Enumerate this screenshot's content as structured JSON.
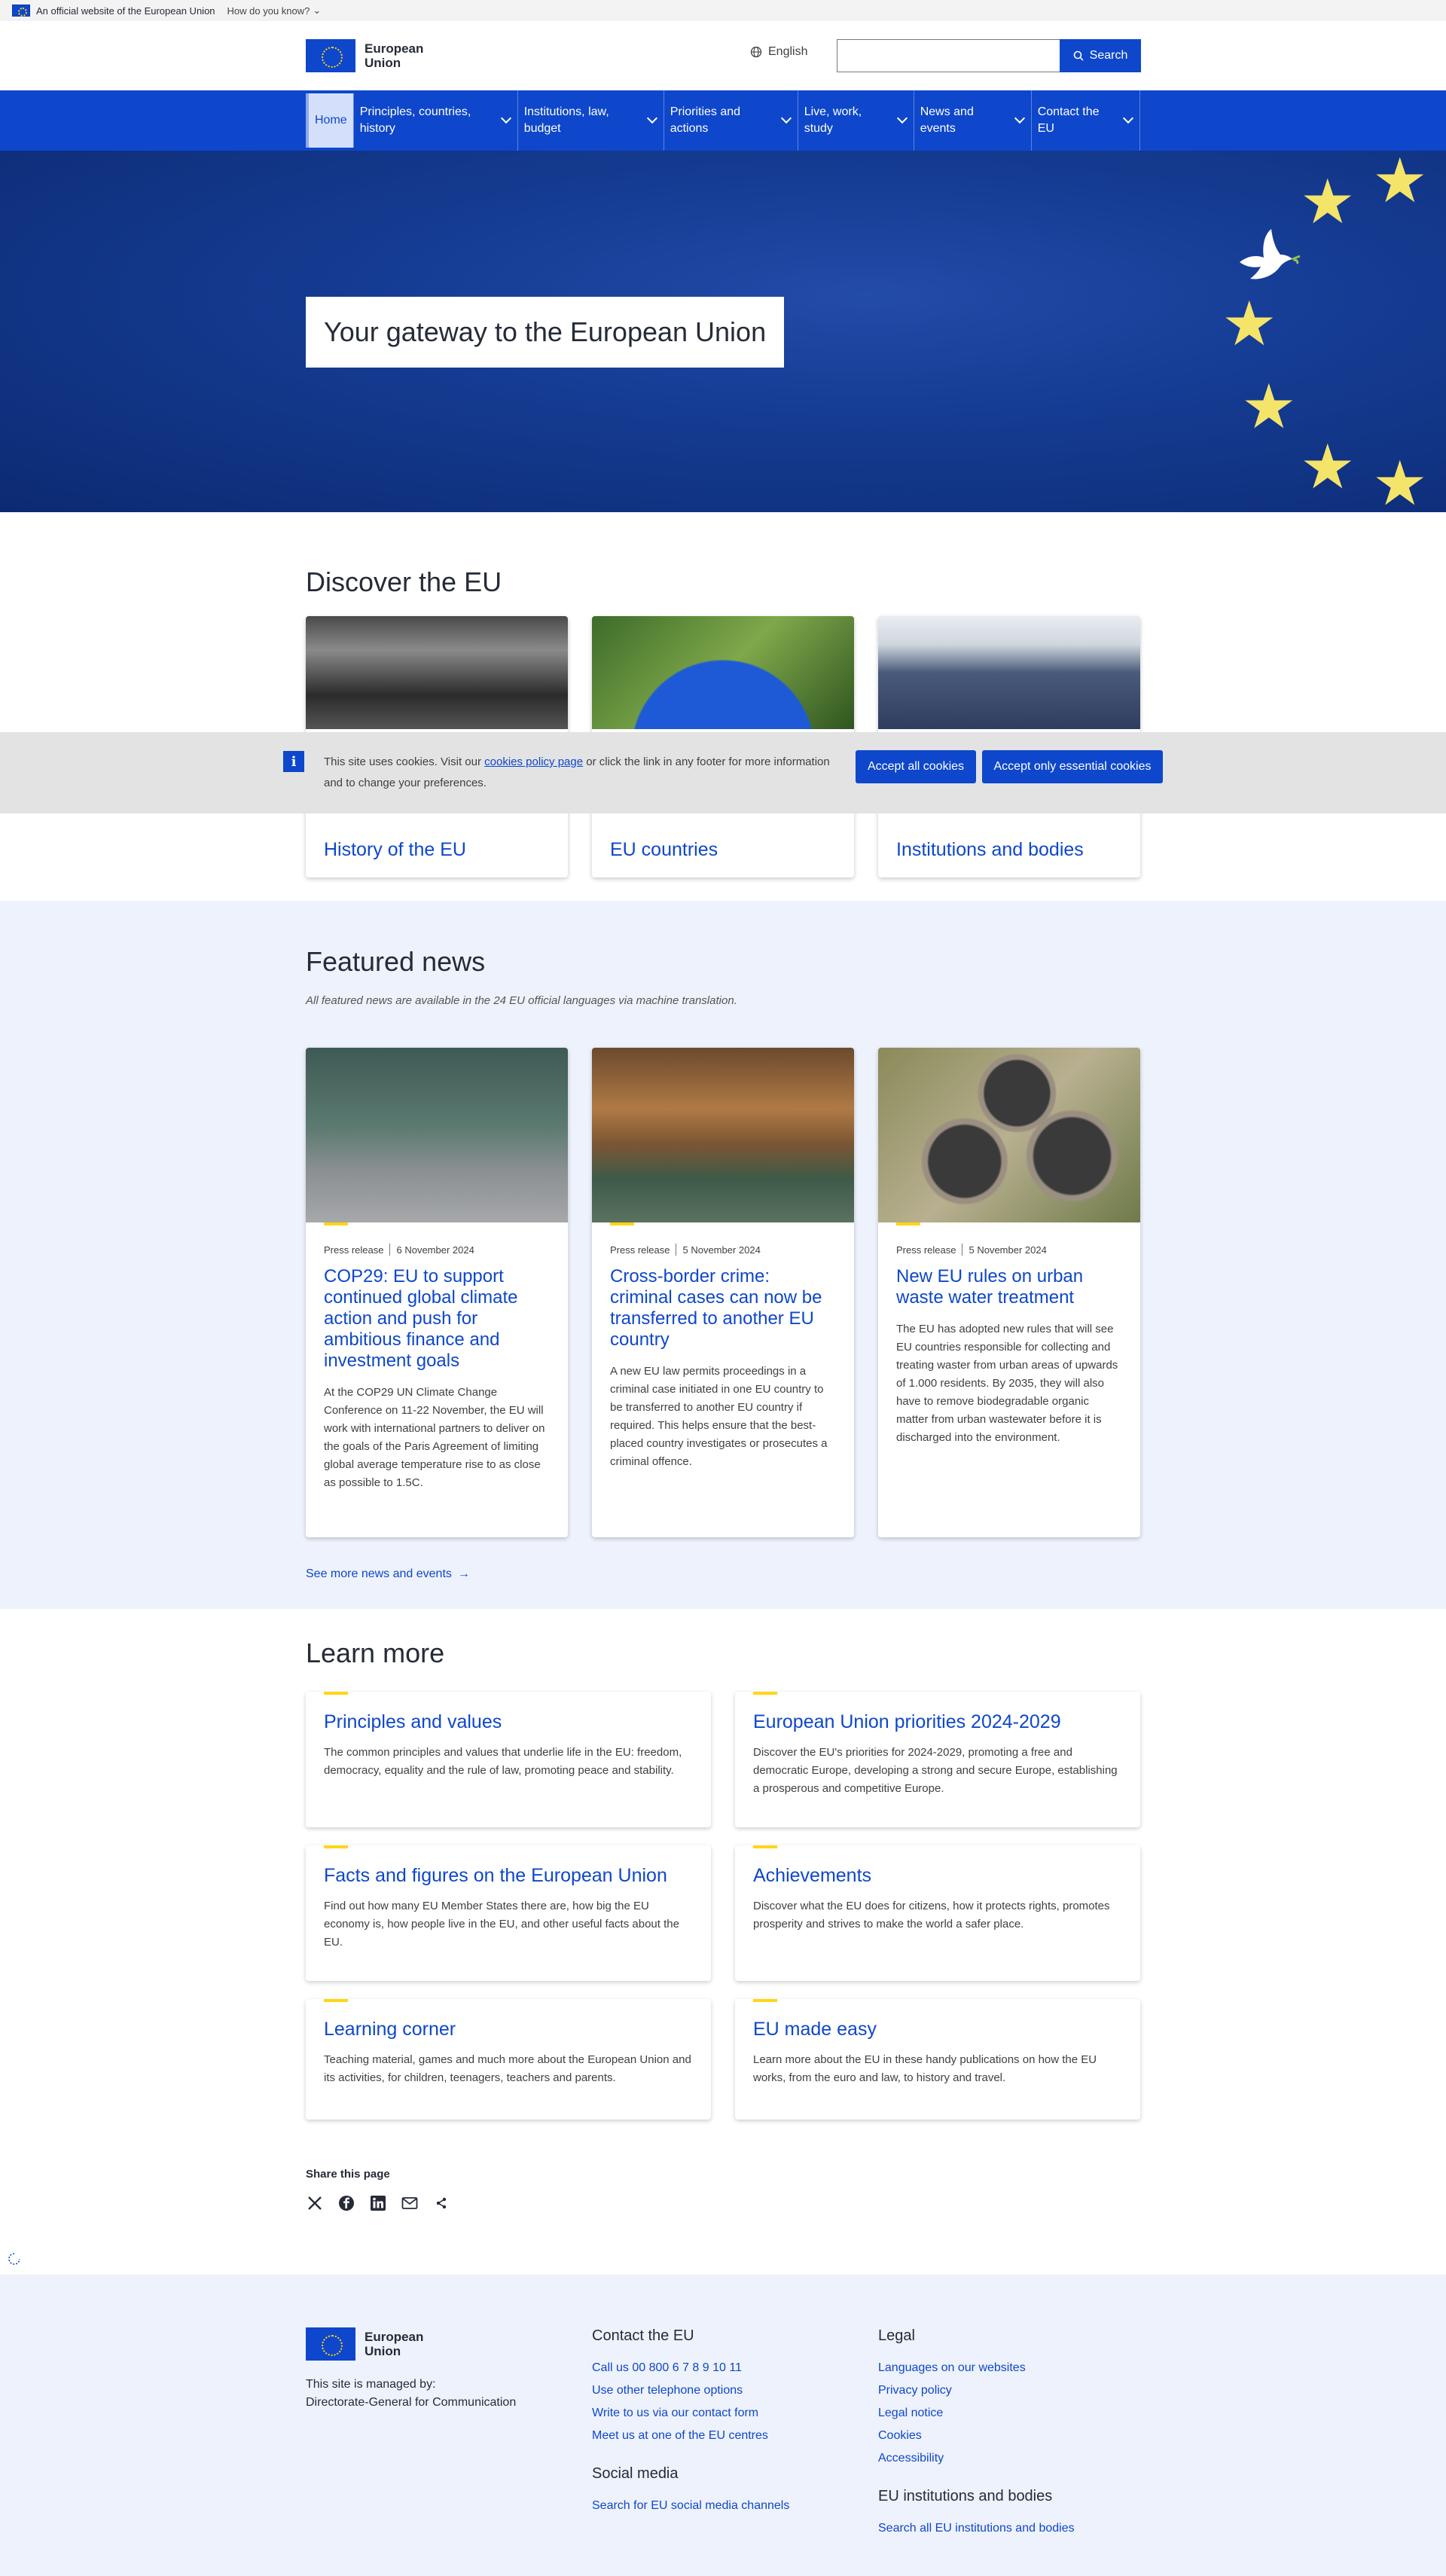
{
  "official": {
    "text": "An official website of the European Union",
    "how": "How do you know?"
  },
  "header": {
    "logo_line1": "European",
    "logo_line2": "Union",
    "language": "English",
    "search_placeholder": "",
    "search_button": "Search"
  },
  "nav": {
    "home": "Home",
    "items": [
      {
        "l1": "Principles, countries,",
        "l2": "history"
      },
      {
        "l1": "Institutions, law,",
        "l2": "budget"
      },
      {
        "l1": "Priorities and",
        "l2": "actions"
      },
      {
        "l1": "Live, work,",
        "l2": "study"
      },
      {
        "l1": "News and",
        "l2": "events"
      },
      {
        "l1": "Contact the",
        "l2": "EU"
      }
    ]
  },
  "hero": {
    "title": "Your gateway to the European Union"
  },
  "discover": {
    "heading": "Discover the EU",
    "cards": [
      {
        "title": "History of the EU"
      },
      {
        "title": "EU countries"
      },
      {
        "title": "Institutions and bodies"
      }
    ]
  },
  "cookie": {
    "text_before": "This site uses cookies. Visit our ",
    "link": "cookies policy page",
    "text_after": " or click the link in any footer for more information and to change your preferences.",
    "accept_all": "Accept all cookies",
    "accept_essential": "Accept only essential cookies"
  },
  "news": {
    "heading": "Featured news",
    "subtitle": "All featured news are available in the 24 EU official languages via machine translation.",
    "cards": [
      {
        "type": "Press release",
        "date": "6 November 2024",
        "title": "COP29: EU to support continued global climate action and push for ambitious finance and investment goals",
        "text": "At the COP29 UN Climate Change Conference on 11-22 November, the EU will work with international partners to deliver on the goals of the Paris Agreement of limiting global average temperature rise to as close as possible to 1.5C."
      },
      {
        "type": "Press release",
        "date": "5 November 2024",
        "title": "Cross-border crime: criminal cases can now be transferred to another EU country",
        "text": "A new EU law permits proceedings in a criminal case initiated in one EU country to be transferred to another EU country if required. This helps ensure that the best-placed country investigates or prosecutes a criminal offence."
      },
      {
        "type": "Press release",
        "date": "5 November 2024",
        "title": "New EU rules on urban waste water treatment",
        "text": "The EU has adopted new rules that will see EU countries responsible for collecting and treating waster from urban areas of upwards of 1.000 residents. By 2035, they will also have to remove biodegradable organic matter from urban wastewater before it is discharged into the environment."
      }
    ],
    "more": "See more news and events"
  },
  "learn": {
    "heading": "Learn more",
    "cards": [
      {
        "title": "Principles and values",
        "text": "The common principles and values that underlie life in the EU: freedom, democracy, equality and the rule of law, promoting peace and stability."
      },
      {
        "title": "European Union priorities 2024-2029",
        "text": "Discover the EU's priorities for 2024-2029, promoting a free and democratic Europe, developing a strong and secure Europe, establishing a prosperous and competitive Europe."
      },
      {
        "title": "Facts and figures on the European Union",
        "text": "Find out how many EU Member States there are, how big the EU economy is, how people live in the EU, and other useful facts about the EU."
      },
      {
        "title": "Achievements",
        "text": "Discover what the EU does for citizens, how it protects rights, promotes prosperity and strives to make the world a safer place."
      },
      {
        "title": "Learning corner",
        "text": "Teaching material, games and much more about the European Union and its activities, for children, teenagers, teachers and parents."
      },
      {
        "title": "EU made easy",
        "text": "Learn more about the EU in these handy publications on how the EU works, from the euro and law, to history and travel."
      }
    ]
  },
  "share": {
    "heading": "Share this page",
    "icons": [
      "x-icon",
      "facebook-icon",
      "linkedin-icon",
      "email-icon",
      "share-icon"
    ]
  },
  "footer": {
    "logo_line1": "European",
    "logo_line2": "Union",
    "managed_1": "This site is managed by:",
    "managed_2": "Directorate-General for Communication",
    "contact_heading": "Contact the EU",
    "contact_links": [
      "Call us 00 800 6 7 8 9 10 11",
      "Use other telephone options",
      "Write to us via our contact form",
      "Meet us at one of the EU centres"
    ],
    "social_heading": "Social media",
    "social_links": [
      "Search for EU social media channels"
    ],
    "legal_heading": "Legal",
    "legal_links": [
      "Languages on our websites",
      "Privacy policy",
      "Legal notice",
      "Cookies",
      "Accessibility"
    ],
    "inst_heading": "EU institutions and bodies",
    "inst_links": [
      "Search all EU institutions and bodies"
    ]
  },
  "colors": {
    "brand": "#0e47cb",
    "accent": "#ffd617",
    "hero": "#153c93",
    "news_bg": "#eef2fc"
  }
}
